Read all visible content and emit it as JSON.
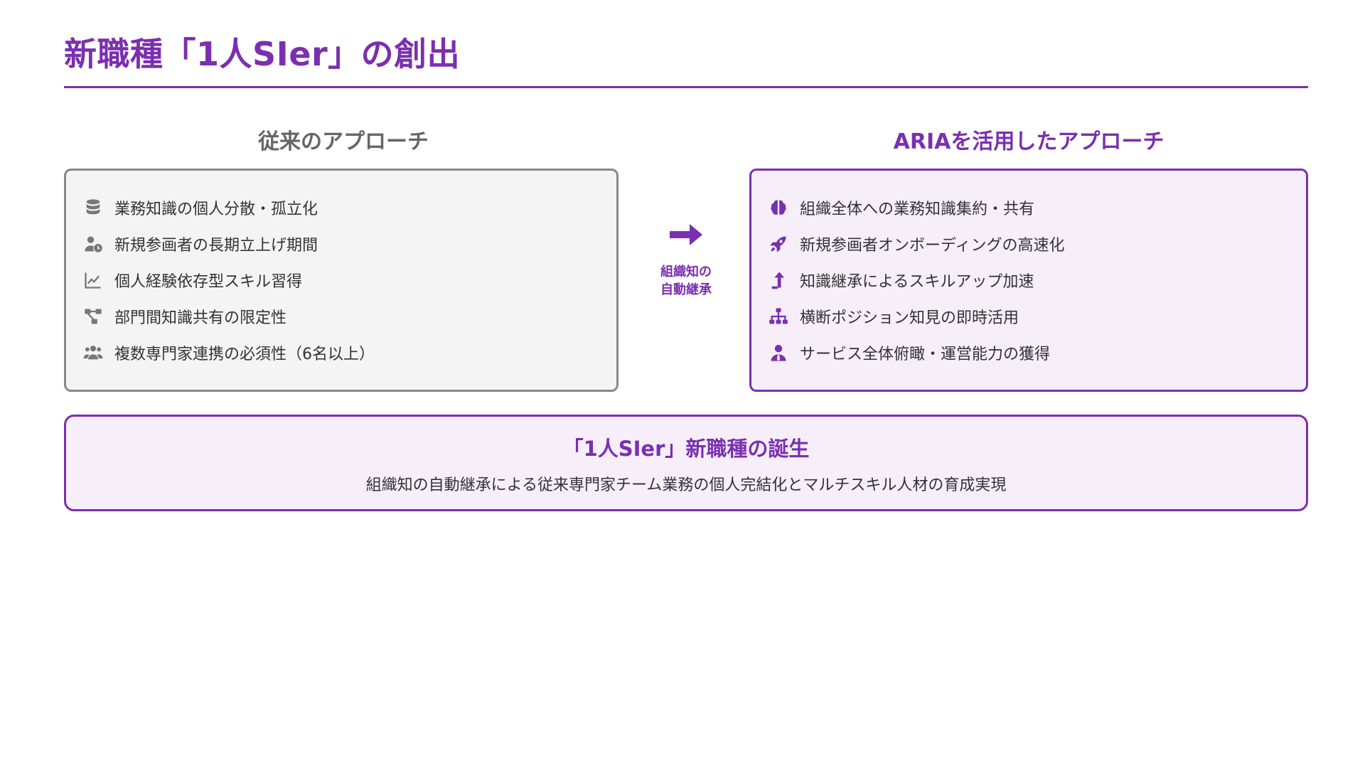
{
  "title": "新職種「1人SIer」の創出",
  "left": {
    "heading": "従来のアプローチ",
    "items": [
      {
        "icon": "database-icon",
        "label": "業務知識の個人分散・孤立化"
      },
      {
        "icon": "user-clock-icon",
        "label": "新規参画者の長期立上げ期間"
      },
      {
        "icon": "line-chart-icon",
        "label": "個人経験依存型スキル習得"
      },
      {
        "icon": "project-diagram-icon",
        "label": "部門間知識共有の限定性"
      },
      {
        "icon": "users-icon",
        "label": "複数専門家連携の必須性（6名以上）"
      }
    ]
  },
  "arrow": {
    "label_line1": "組織知の",
    "label_line2": "自動継承"
  },
  "right": {
    "heading": "ARIAを活用したアプローチ",
    "items": [
      {
        "icon": "brain-icon",
        "label": "組織全体への業務知識集約・共有"
      },
      {
        "icon": "rocket-icon",
        "label": "新規参画者オンボーディングの高速化"
      },
      {
        "icon": "level-up-arrow-icon",
        "label": "知識継承によるスキルアップ加速"
      },
      {
        "icon": "sitemap-icon",
        "label": "横断ポジション知見の即時活用"
      },
      {
        "icon": "user-tie-icon",
        "label": "サービス全体俯瞰・運営能力の獲得"
      }
    ]
  },
  "bottom": {
    "title": "「1人SIer」新職種の誕生",
    "text": "組織知の自動継承による従来専門家チーム業務の個人完結化とマルチスキル人材の育成実現"
  },
  "colors": {
    "accent": "#7b2fb0",
    "muted": "#777777",
    "left_panel_bg": "#f4f4f4",
    "right_panel_bg": "#f6eef9"
  }
}
